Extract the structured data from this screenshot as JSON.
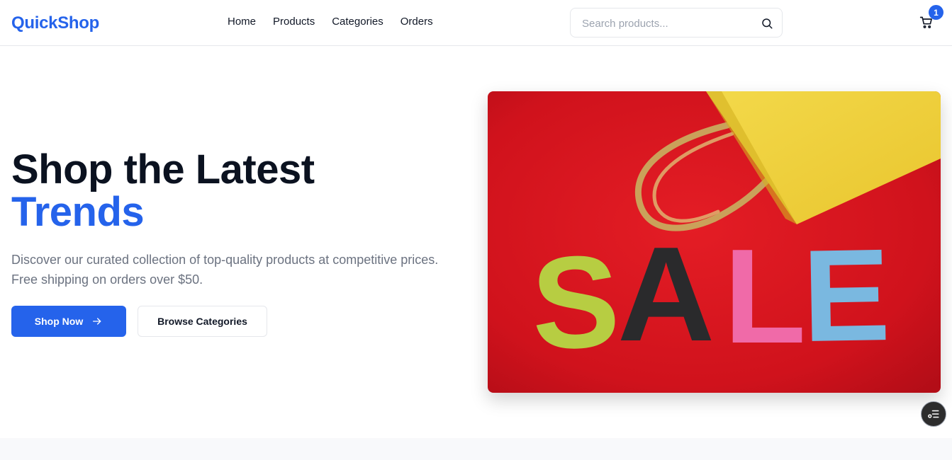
{
  "header": {
    "logo": "QuickShop",
    "nav": [
      "Home",
      "Products",
      "Categories",
      "Orders"
    ],
    "search": {
      "placeholder": "Search products...",
      "value": "",
      "icon": "search-icon"
    },
    "cart": {
      "icon": "shopping-cart-icon",
      "count": "1"
    }
  },
  "hero": {
    "title_line1": "Shop the Latest",
    "title_line2": "Trends",
    "description": "Discover our curated collection of top-quality products at competitive prices. Free shipping on orders over $50.",
    "primary_button": "Shop Now",
    "primary_button_icon": "arrow-right-icon",
    "secondary_button": "Browse Categories",
    "image": {
      "subject": "shopping-bag-sale-image",
      "letters": [
        "S",
        "A",
        "L",
        "E"
      ]
    }
  },
  "floating_button": {
    "icon": "list-settings-icon"
  },
  "colors": {
    "brand": "#2563eb",
    "text_dark": "#0b1220",
    "muted": "#6b7280",
    "sale_red": "#d8141e",
    "bag_yellow": "#f0d23c",
    "letter_green": "#b7cd42",
    "letter_black": "#2a2a2c",
    "letter_pink": "#f06aa8",
    "letter_blue": "#7ab8e0"
  }
}
